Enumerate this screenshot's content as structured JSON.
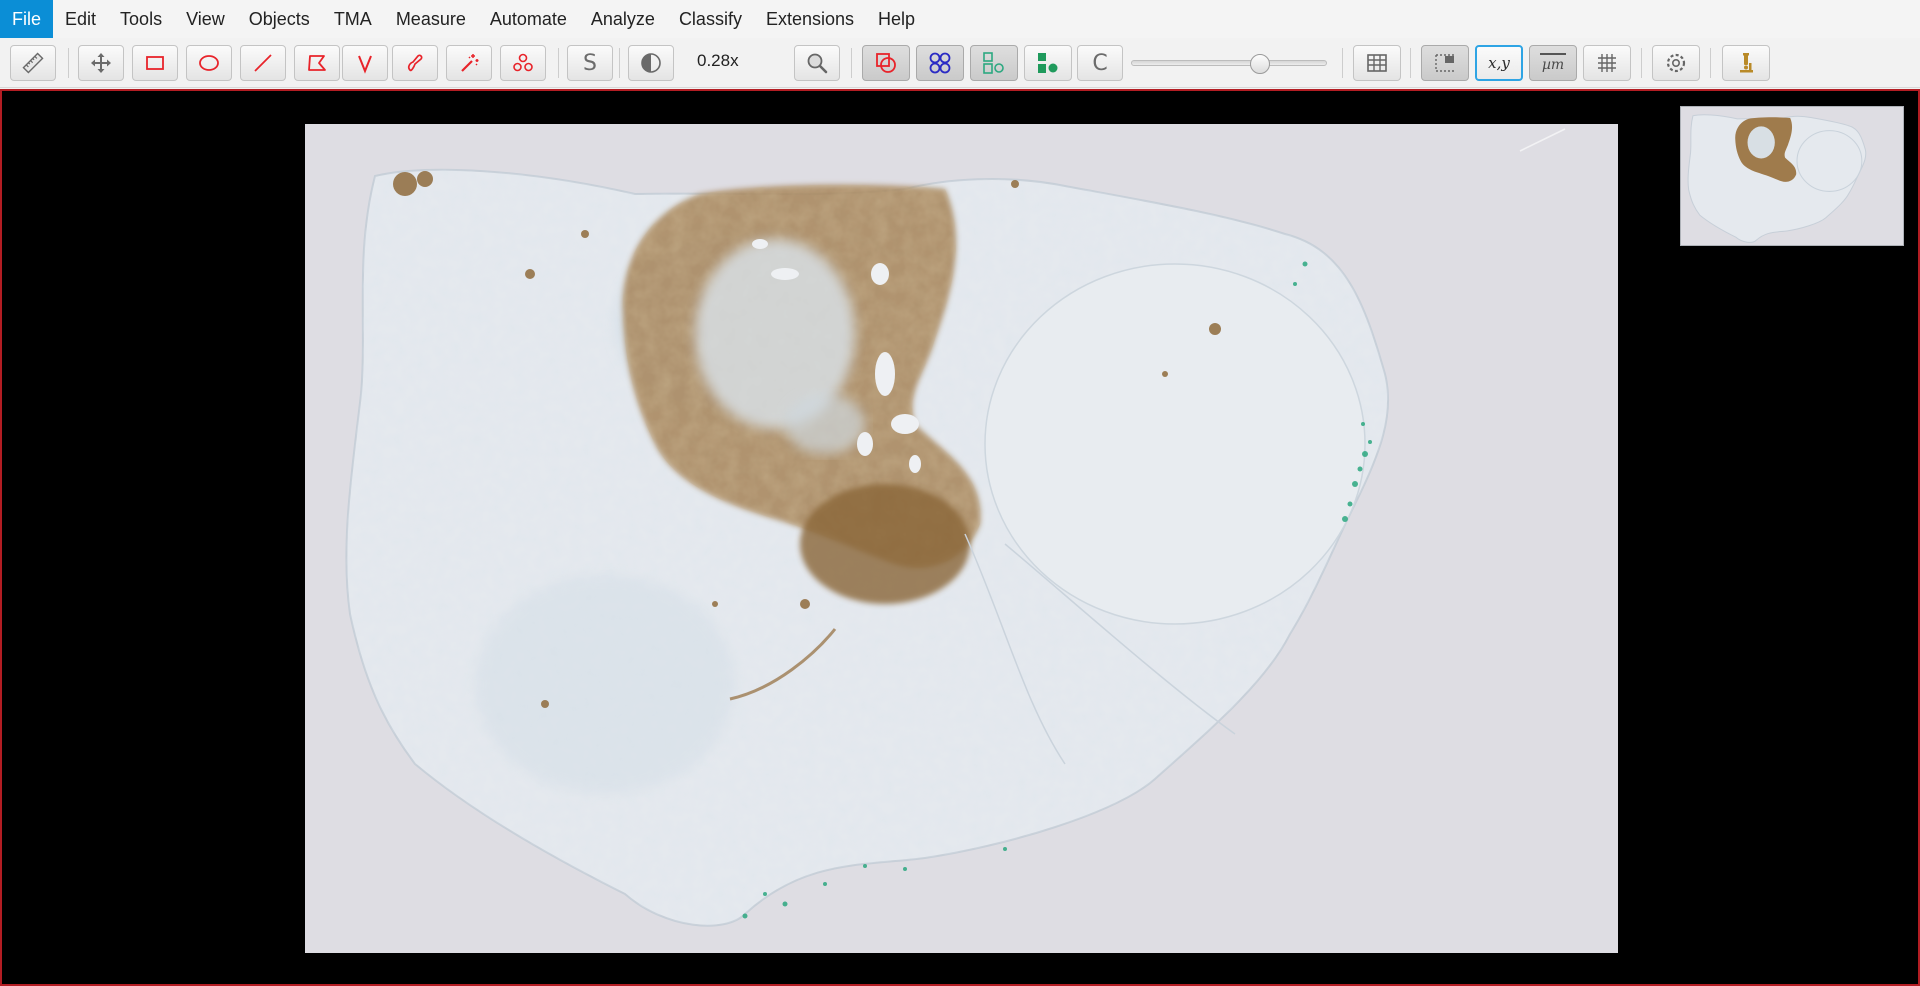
{
  "menu": {
    "items": [
      "File",
      "Edit",
      "Tools",
      "View",
      "Objects",
      "TMA",
      "Measure",
      "Automate",
      "Analyze",
      "Classify",
      "Extensions",
      "Help"
    ],
    "active": "File"
  },
  "toolbar": {
    "zoom_label": "0.28x",
    "selection_mode_label": "S",
    "cell_mode_label": "C",
    "xy_label": "x,y",
    "um_label": "µm",
    "opacity_slider_value": 0.67
  },
  "colors": {
    "accent": "#0b8ed6",
    "annotation_red": "#e8232a",
    "viewer_border": "#b31d23",
    "stain_brown": "#8f6a3e",
    "stain_green": "#2ca880",
    "tissue": "#e4e8ec"
  },
  "icons": [
    "ruler-icon",
    "move-icon",
    "rectangle-icon",
    "ellipse-icon",
    "line-icon",
    "polygon-icon",
    "polyline-icon",
    "brush-icon",
    "wand-icon",
    "points-icon",
    "contrast-icon",
    "zoom-fit-icon",
    "show-annotations-icon",
    "show-tma-grid-icon",
    "show-detections-icon",
    "fill-detections-icon",
    "measurement-table-icon",
    "overview-icon",
    "location-icon",
    "scalebar-icon",
    "grid-icon",
    "preferences-icon",
    "microscope-icon"
  ]
}
